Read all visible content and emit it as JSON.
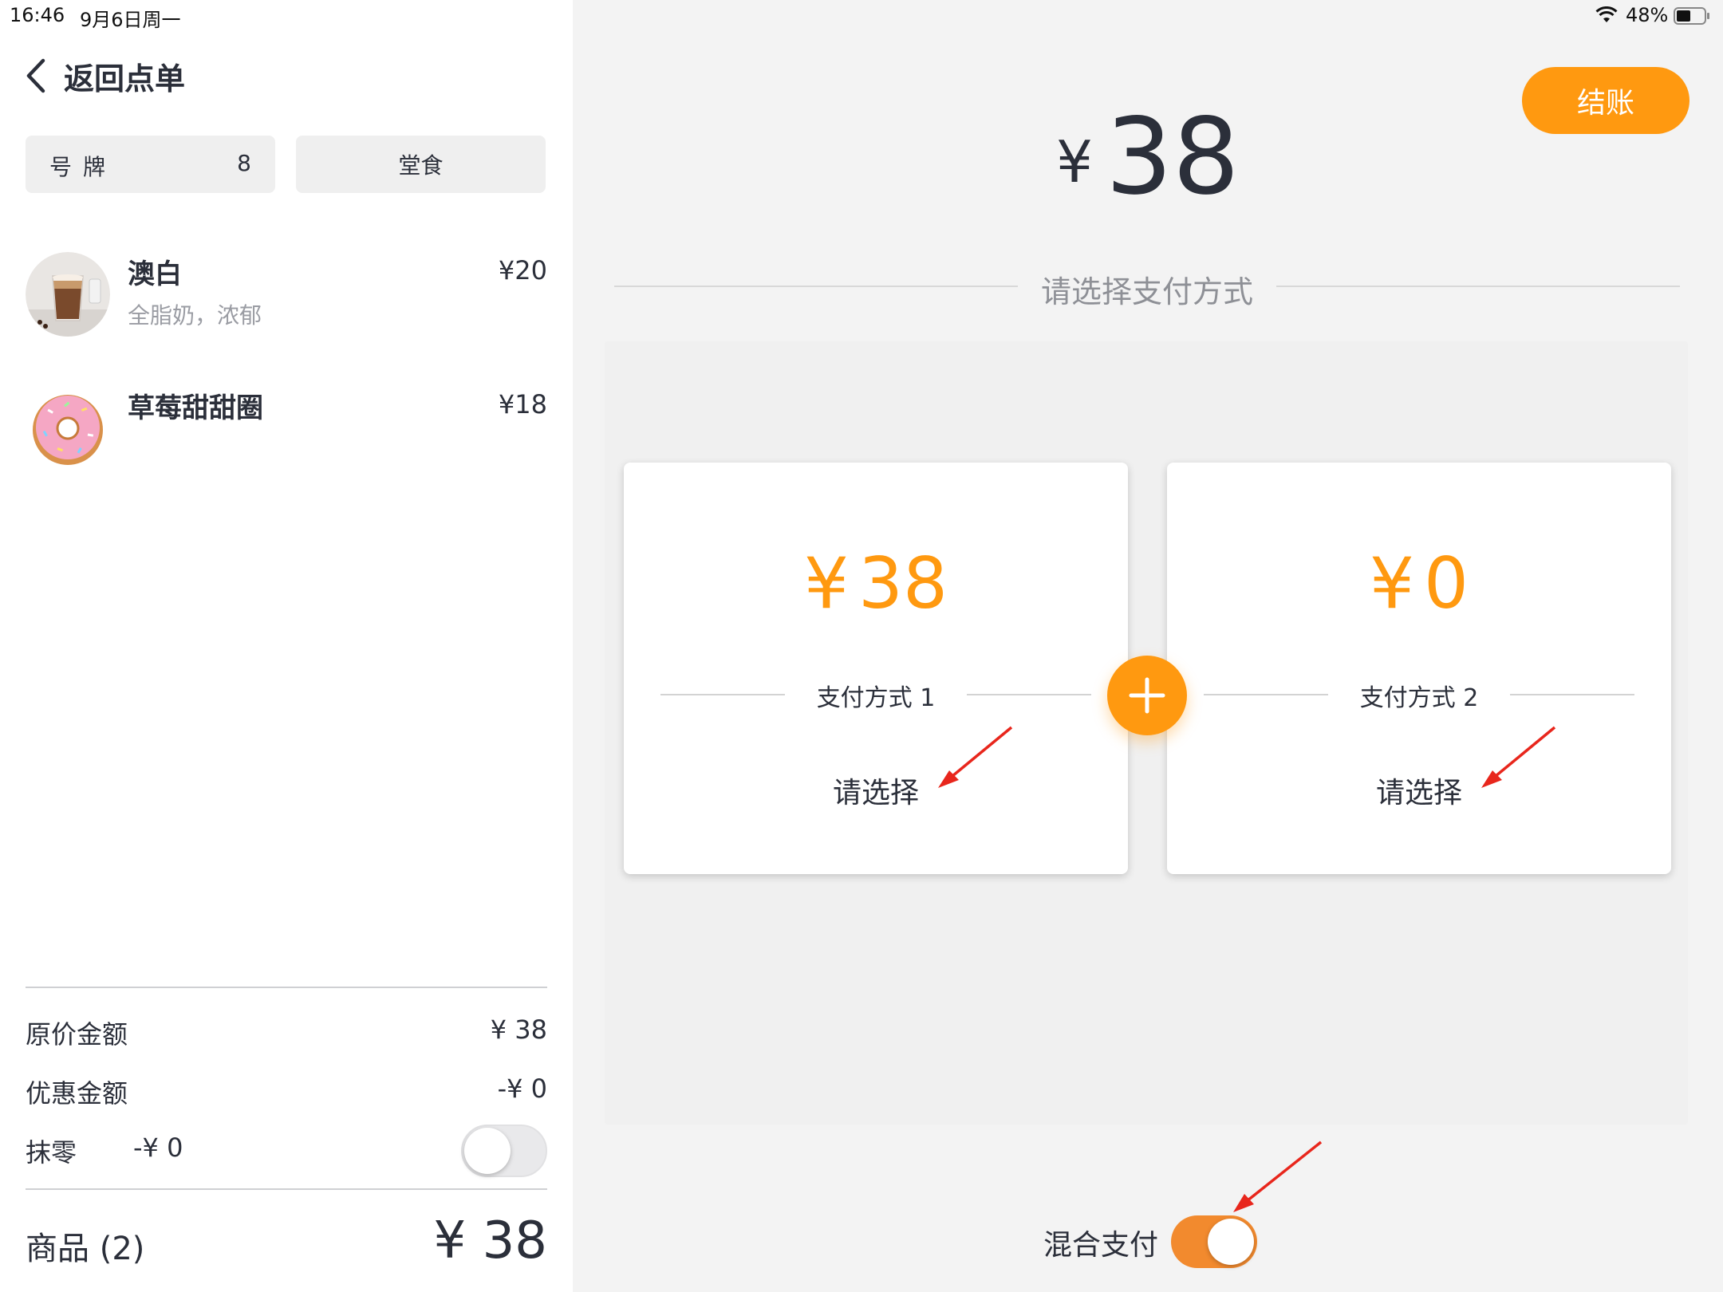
{
  "status_bar": {
    "time": "16:46",
    "date": "9月6日周一",
    "battery": "48%"
  },
  "left": {
    "back_label": "返回点单",
    "number_label": "号牌",
    "number_value": "8",
    "dine_label": "堂食",
    "items": [
      {
        "name": "澳白",
        "desc": "全脂奶，浓郁",
        "price": "¥20",
        "icon": "coffee-thumbnail"
      },
      {
        "name": "草莓甜甜圈",
        "desc": "",
        "price": "¥18",
        "icon": "donut-thumbnail"
      }
    ],
    "summary": {
      "original_label": "原价金额",
      "original_value": "¥ 38",
      "discount_label": "优惠金额",
      "discount_value": "-¥ 0",
      "round_label": "抹零",
      "round_value": "-¥ 0",
      "round_toggle": false
    },
    "total_label": "商品 (2)",
    "total_value": "¥ 38"
  },
  "right": {
    "checkout_label": "结账",
    "grand_total_currency": "¥",
    "grand_total_amount": "38",
    "method_title": "请选择支付方式",
    "cards": [
      {
        "currency": "¥",
        "amount": "38",
        "method_label": "支付方式 1",
        "select_label": "请选择"
      },
      {
        "currency": "¥",
        "amount": "0",
        "method_label": "支付方式 2",
        "select_label": "请选择"
      }
    ],
    "mixed_label": "混合支付",
    "mixed_toggle": true
  },
  "colors": {
    "accent": "#ff9910",
    "toggle_on": "#f28a2e",
    "annotation_arrow": "#e8261c"
  }
}
